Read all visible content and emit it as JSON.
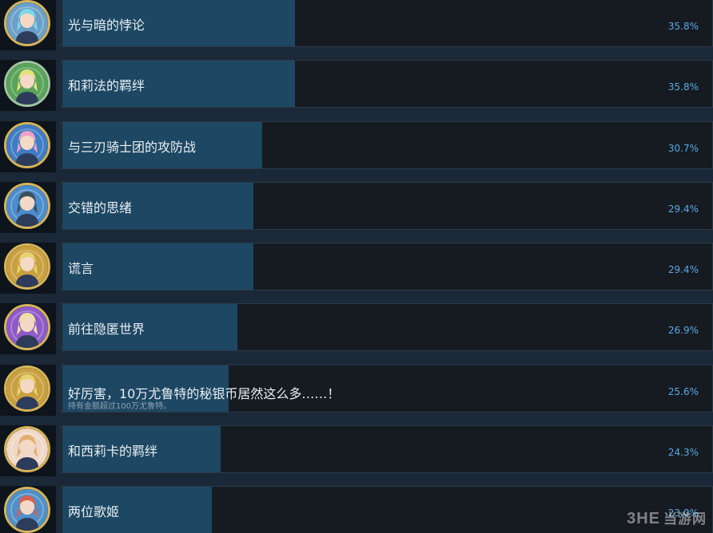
{
  "achievements": [
    {
      "title": "光与暗的悖论",
      "description": "",
      "percent": "35.8%",
      "unlock_fraction": 0.358,
      "frame_color": "#d6b45a",
      "inner_color": "#6aa0c8",
      "hair_color": "#7ed7e8"
    },
    {
      "title": "和莉法的羁绊",
      "description": "",
      "percent": "35.8%",
      "unlock_fraction": 0.358,
      "frame_color": "#9fc4a2",
      "inner_color": "#5aa35a",
      "hair_color": "#e3e07a"
    },
    {
      "title": "与三刃骑士团的攻防战",
      "description": "",
      "percent": "30.7%",
      "unlock_fraction": 0.307,
      "frame_color": "#d6b45a",
      "inner_color": "#3e7cc4",
      "hair_color": "#f0a0c8"
    },
    {
      "title": "交错的思绪",
      "description": "",
      "percent": "29.4%",
      "unlock_fraction": 0.294,
      "frame_color": "#d6b45a",
      "inner_color": "#4a8ccc",
      "hair_color": "#40505a"
    },
    {
      "title": "谎言",
      "description": "",
      "percent": "29.4%",
      "unlock_fraction": 0.294,
      "frame_color": "#d6b45a",
      "inner_color": "#c9a040",
      "hair_color": "#e8d070"
    },
    {
      "title": "前往隐匿世界",
      "description": "",
      "percent": "26.9%",
      "unlock_fraction": 0.269,
      "frame_color": "#d6b45a",
      "inner_color": "#8e5ac8",
      "hair_color": "#f0e0a0"
    },
    {
      "title": "好厉害，10万尤鲁特的秘银币居然这么多……！",
      "description": "持有金额超过100万尤鲁特。",
      "percent": "25.6%",
      "unlock_fraction": 0.256,
      "frame_color": "#d6b45a",
      "inner_color": "#c8a040",
      "hair_color": "#e8d070"
    },
    {
      "title": "和西莉卡的羁绊",
      "description": "",
      "percent": "24.3%",
      "unlock_fraction": 0.243,
      "frame_color": "#d6b45a",
      "inner_color": "#f0d8c8",
      "hair_color": "#e0b070"
    },
    {
      "title": "两位歌姬",
      "description": "",
      "percent": "23.0%",
      "unlock_fraction": 0.23,
      "frame_color": "#d6b45a",
      "inner_color": "#5090c8",
      "hair_color": "#d86050"
    }
  ],
  "watermark": {
    "brand": "3HE",
    "site": "当游网"
  }
}
